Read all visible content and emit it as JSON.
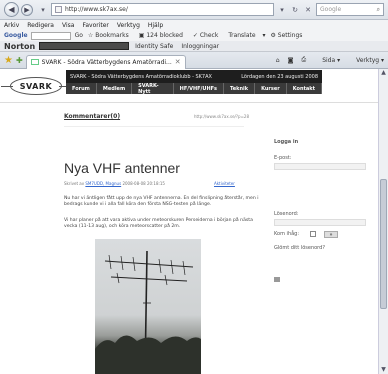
{
  "browser": {
    "url": "http://www.sk7ax.se/",
    "search_placeholder": "Google",
    "menu": [
      "Arkiv",
      "Redigera",
      "Visa",
      "Favoriter",
      "Verktyg",
      "Hjälp"
    ],
    "google_toolbar": {
      "logo": "Google",
      "items": [
        "Go",
        "Bookmarks",
        "124 blocked",
        "Check",
        "Translate",
        "Settings"
      ]
    },
    "norton_toolbar": {
      "logo": "Norton",
      "items": [
        "Identity Safe",
        "Inloggningar"
      ]
    },
    "tab_title": "SVARK - Södra Vätterbygdens Amatörradi...",
    "tab_tools": [
      "Sida",
      "Verktyg"
    ]
  },
  "site": {
    "logo_text": "SVARK",
    "banner_title": "SVARK - Södra Vätterbygdens Amatörradioklubb - SK7AX",
    "banner_date": "Lördagen den 23 augusti 2008",
    "nav": [
      "Forum",
      "Medlem",
      "SVARK-Nytt",
      "HF/VHF/UHFs",
      "Teknik",
      "Kurser",
      "Kontakt"
    ]
  },
  "content": {
    "comments_link": "Kommentarer(0)",
    "comments_url": "http://www.sk7ax.se/?p=28",
    "post_title": "Nya VHF antenner",
    "post_meta_prefix": "Skrivet av",
    "post_author": "SM7UDD, Magnus",
    "post_date": "2008-08-08 20:18:15",
    "post_category": "Aktiviteter",
    "paragraph1": "Nu har vi äntligen fått upp de nya VHF antennerna. En del finslipning återstår, men i bedrags kunde vi i alla fall köra den första NSG-testen på länge.",
    "paragraph2": "Vi har planer på att vara aktiva under meteorskuren Perseiderna i början på nästa vecka (11-13 aug), och köra meteorscatter på 2m."
  },
  "sidebar": {
    "login_heading": "Logga in",
    "email_label": "E-post:",
    "password_label": "Lösenord:",
    "remember_label": "Kom ihåg:",
    "go_label": "»",
    "forgot_label": "Glömt ditt lösenord?"
  }
}
